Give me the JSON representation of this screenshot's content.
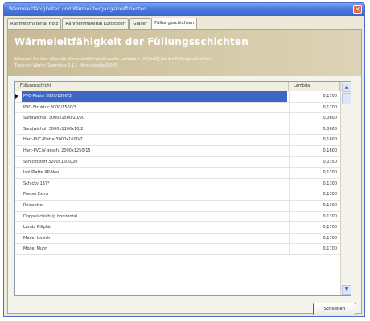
{
  "window": {
    "title": "Wärmeleitfähigkeiten und Wärmeübergangskoeffizienten",
    "close_glyph": "×"
  },
  "tabs": [
    {
      "label": "Rahmenmaterial Holz"
    },
    {
      "label": "Rahmenmaterial Kunststoff"
    },
    {
      "label": "Gläser"
    },
    {
      "label": "Füllungsschichten"
    }
  ],
  "active_tab": 3,
  "banner": {
    "title": "Wärmeleitfähigkeit der Füllungsschichten",
    "line1": "Erfassen Sie hier bitte die Wärmeleitfähigkeitswerte Lambda λ [W/(mK)] für die Füllungsschichten.",
    "line2": "Typische Werte: Sperrholz 0,13, Mineralwolle 0,035"
  },
  "table": {
    "columns": [
      "Füllungsschicht",
      "Lambda"
    ],
    "selected_index": 0,
    "rows": [
      {
        "name": "PVC-Platte 3000/1500/3",
        "value": "0,1700"
      },
      {
        "name": "PVC-Struktur 3000/1500/3",
        "value": "0,1700"
      },
      {
        "name": "Sandwichpl. 3000x1500/20/20",
        "value": "0,0600"
      },
      {
        "name": "Sandwichpl. 3000x1100x10/2",
        "value": "0,0600"
      },
      {
        "name": "Hart-PVC-Platte 3000x1600/2",
        "value": "0,1600"
      },
      {
        "name": "Hart-PVC/V-gesch. 2000x1250/15",
        "value": "0,1600"
      },
      {
        "name": "Schichtstoff 3200x1500/20",
        "value": "0,0350"
      },
      {
        "name": "Isol.Platte XP-Neo",
        "value": "0,1300"
      },
      {
        "name": "Schicky 137*",
        "value": "0,1300"
      },
      {
        "name": "Presso Extra",
        "value": "0,1300"
      },
      {
        "name": "Reinsetter",
        "value": "0,1300"
      },
      {
        "name": "Doppelschicht/g horizontal",
        "value": "0,1300"
      },
      {
        "name": "Lambl Rillplat",
        "value": "0,1700"
      },
      {
        "name": "Model Unsich",
        "value": "0,1700"
      },
      {
        "name": "Model Muhr",
        "value": "0,1700"
      }
    ]
  },
  "scroll": {
    "up_glyph": "▲",
    "down_glyph": "▼"
  },
  "buttons": {
    "close_label": "Schließen"
  },
  "icons": {
    "row_marker": "row-pointer-icon"
  },
  "colors": {
    "selection": "#3d66c7",
    "banner": "#d2c6a3",
    "titlebar": "#4b79dd"
  }
}
